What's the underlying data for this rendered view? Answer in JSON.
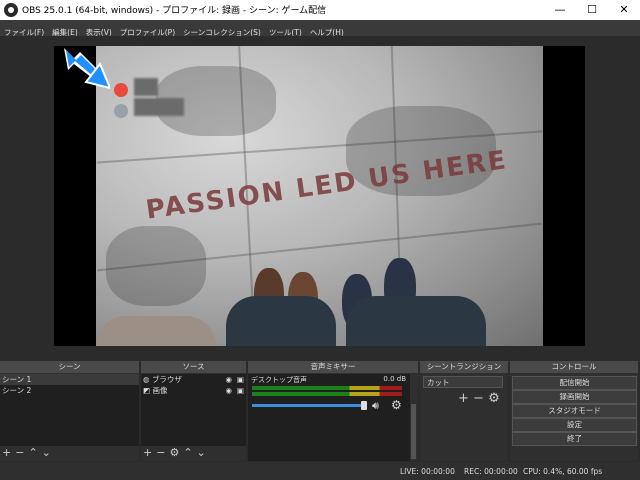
{
  "window": {
    "title": "OBS 25.0.1 (64-bit, windows) - プロファイル: 録画 - シーン: ゲーム配信",
    "minimize": "—",
    "maximize": "☐",
    "close": "✕"
  },
  "menu": [
    "ファイル(F)",
    "編集(E)",
    "表示(V)",
    "プロファイル(P)",
    "シーンコレクション(S)",
    "ツール(T)",
    "ヘルプ(H)"
  ],
  "preview": {
    "overlay_text": "PASSION LED US HERE",
    "arrow_color": "#1e90ff"
  },
  "scenes": {
    "header": "シーン",
    "items": [
      "シーン 1",
      "シーン 2"
    ]
  },
  "sources": {
    "header": "ソース",
    "items": [
      "ブラウザ",
      "画像"
    ]
  },
  "mixer": {
    "header": "音声ミキサー",
    "track_name": "デスクトップ音声",
    "db": "0.0 dB"
  },
  "transitions": {
    "header": "シーントランジション",
    "selected": "カット"
  },
  "controls": {
    "header": "コントロール",
    "buttons": [
      "配信開始",
      "録画開始",
      "スタジオモード",
      "設定",
      "終了"
    ]
  },
  "statusbar": {
    "live": "LIVE: 00:00:00",
    "rec": "REC: 00:00:00",
    "cpu": "CPU: 0.4%, 60.00 fps"
  },
  "colors": {
    "accent": "#1e90ff",
    "discord_red": "#e84a3d"
  }
}
